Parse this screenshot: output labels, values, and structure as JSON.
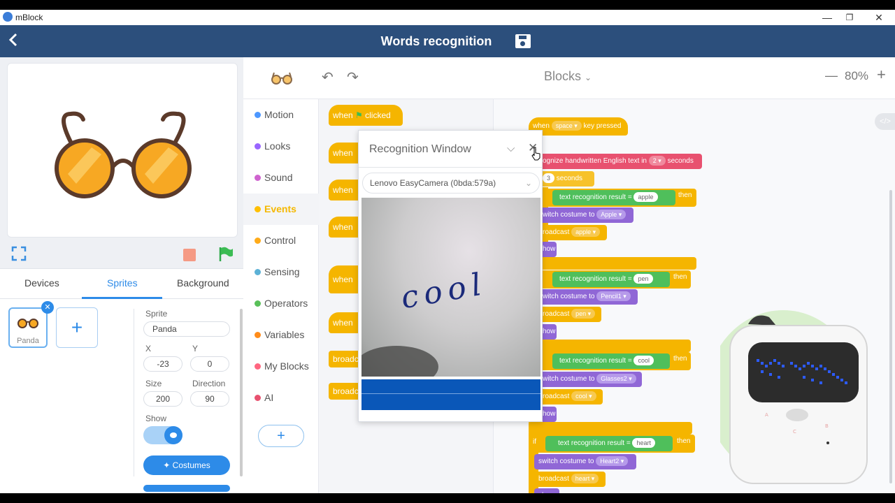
{
  "window": {
    "app_name": "mBlock",
    "minimize": "—",
    "restore": "❐",
    "close": "✕"
  },
  "header": {
    "title": "Words recognition",
    "back_icon": "chevron-left-icon",
    "save_icon": "save-icon"
  },
  "stage_controls": {
    "fullscreen_icon": "fullscreen-icon",
    "stop_icon": "stop-icon",
    "flag_icon": "green-flag-icon"
  },
  "tabs": [
    "Devices",
    "Sprites",
    "Background"
  ],
  "active_tab": "Sprites",
  "sprite_list": [
    {
      "name": "Panda"
    }
  ],
  "add_sprite": "+",
  "sprite_props": {
    "sprite_label": "Sprite",
    "sprite_value": "Panda",
    "x_label": "X",
    "x_value": "-23",
    "y_label": "Y",
    "y_value": "0",
    "size_label": "Size",
    "size_value": "200",
    "direction_label": "Direction",
    "direction_value": "90",
    "show_label": "Show",
    "show_on": true,
    "costumes_label": "Costumes"
  },
  "categories": [
    {
      "label": "Motion",
      "color": "#4c97ff"
    },
    {
      "label": "Looks",
      "color": "#9966ff"
    },
    {
      "label": "Sound",
      "color": "#cf63cf"
    },
    {
      "label": "Events",
      "color": "#ffbf00",
      "active": true
    },
    {
      "label": "Control",
      "color": "#ffab19"
    },
    {
      "label": "Sensing",
      "color": "#5cb1d6"
    },
    {
      "label": "Operators",
      "color": "#59c059"
    },
    {
      "label": "Variables",
      "color": "#ff8c1a"
    },
    {
      "label": "My Blocks",
      "color": "#ff6680"
    },
    {
      "label": "AI",
      "color": "#e8516f"
    }
  ],
  "add_extension": "+",
  "toolbar": {
    "undo": "↶",
    "redo": "↷",
    "mode": "Blocks",
    "zoom_out": "—",
    "zoom_level": "80%",
    "zoom_in": "+"
  },
  "palette_blocks": [
    "when",
    "clicked",
    "when",
    "when",
    "when",
    "when",
    "when",
    "broadc",
    "broadc"
  ],
  "script": {
    "hat_when": "when",
    "hat_key": "space",
    "hat_pressed": "key pressed",
    "recognize": "ognize handwritten English text in",
    "recognize_secs": "2",
    "seconds": "seconds",
    "wait_secs": "3",
    "wait_seconds": "seconds",
    "cond_label": "text recognition result",
    "eq": "=",
    "then": "then",
    "cases": [
      {
        "word": "apple",
        "costume": "Apple",
        "broadcast": "apple"
      },
      {
        "word": "pen",
        "costume": "Pencil1",
        "broadcast": "pen"
      },
      {
        "word": "cool",
        "costume": "Glasses2",
        "broadcast": "cool"
      },
      {
        "word": "heart",
        "costume": "Heart2",
        "broadcast": "heart"
      }
    ],
    "switch_label": "witch costume to",
    "broadcast_label": "roadcast",
    "show_label": "how",
    "if_label": "if",
    "switch_full": "switch costume to",
    "broadcast_full": "broadcast",
    "show_full": "show"
  },
  "code_toggle": "</>",
  "recognition_window": {
    "title": "Recognition Window",
    "camera": "Lenovo EasyCamera (0bda:579a)",
    "handwriting": "cool"
  }
}
